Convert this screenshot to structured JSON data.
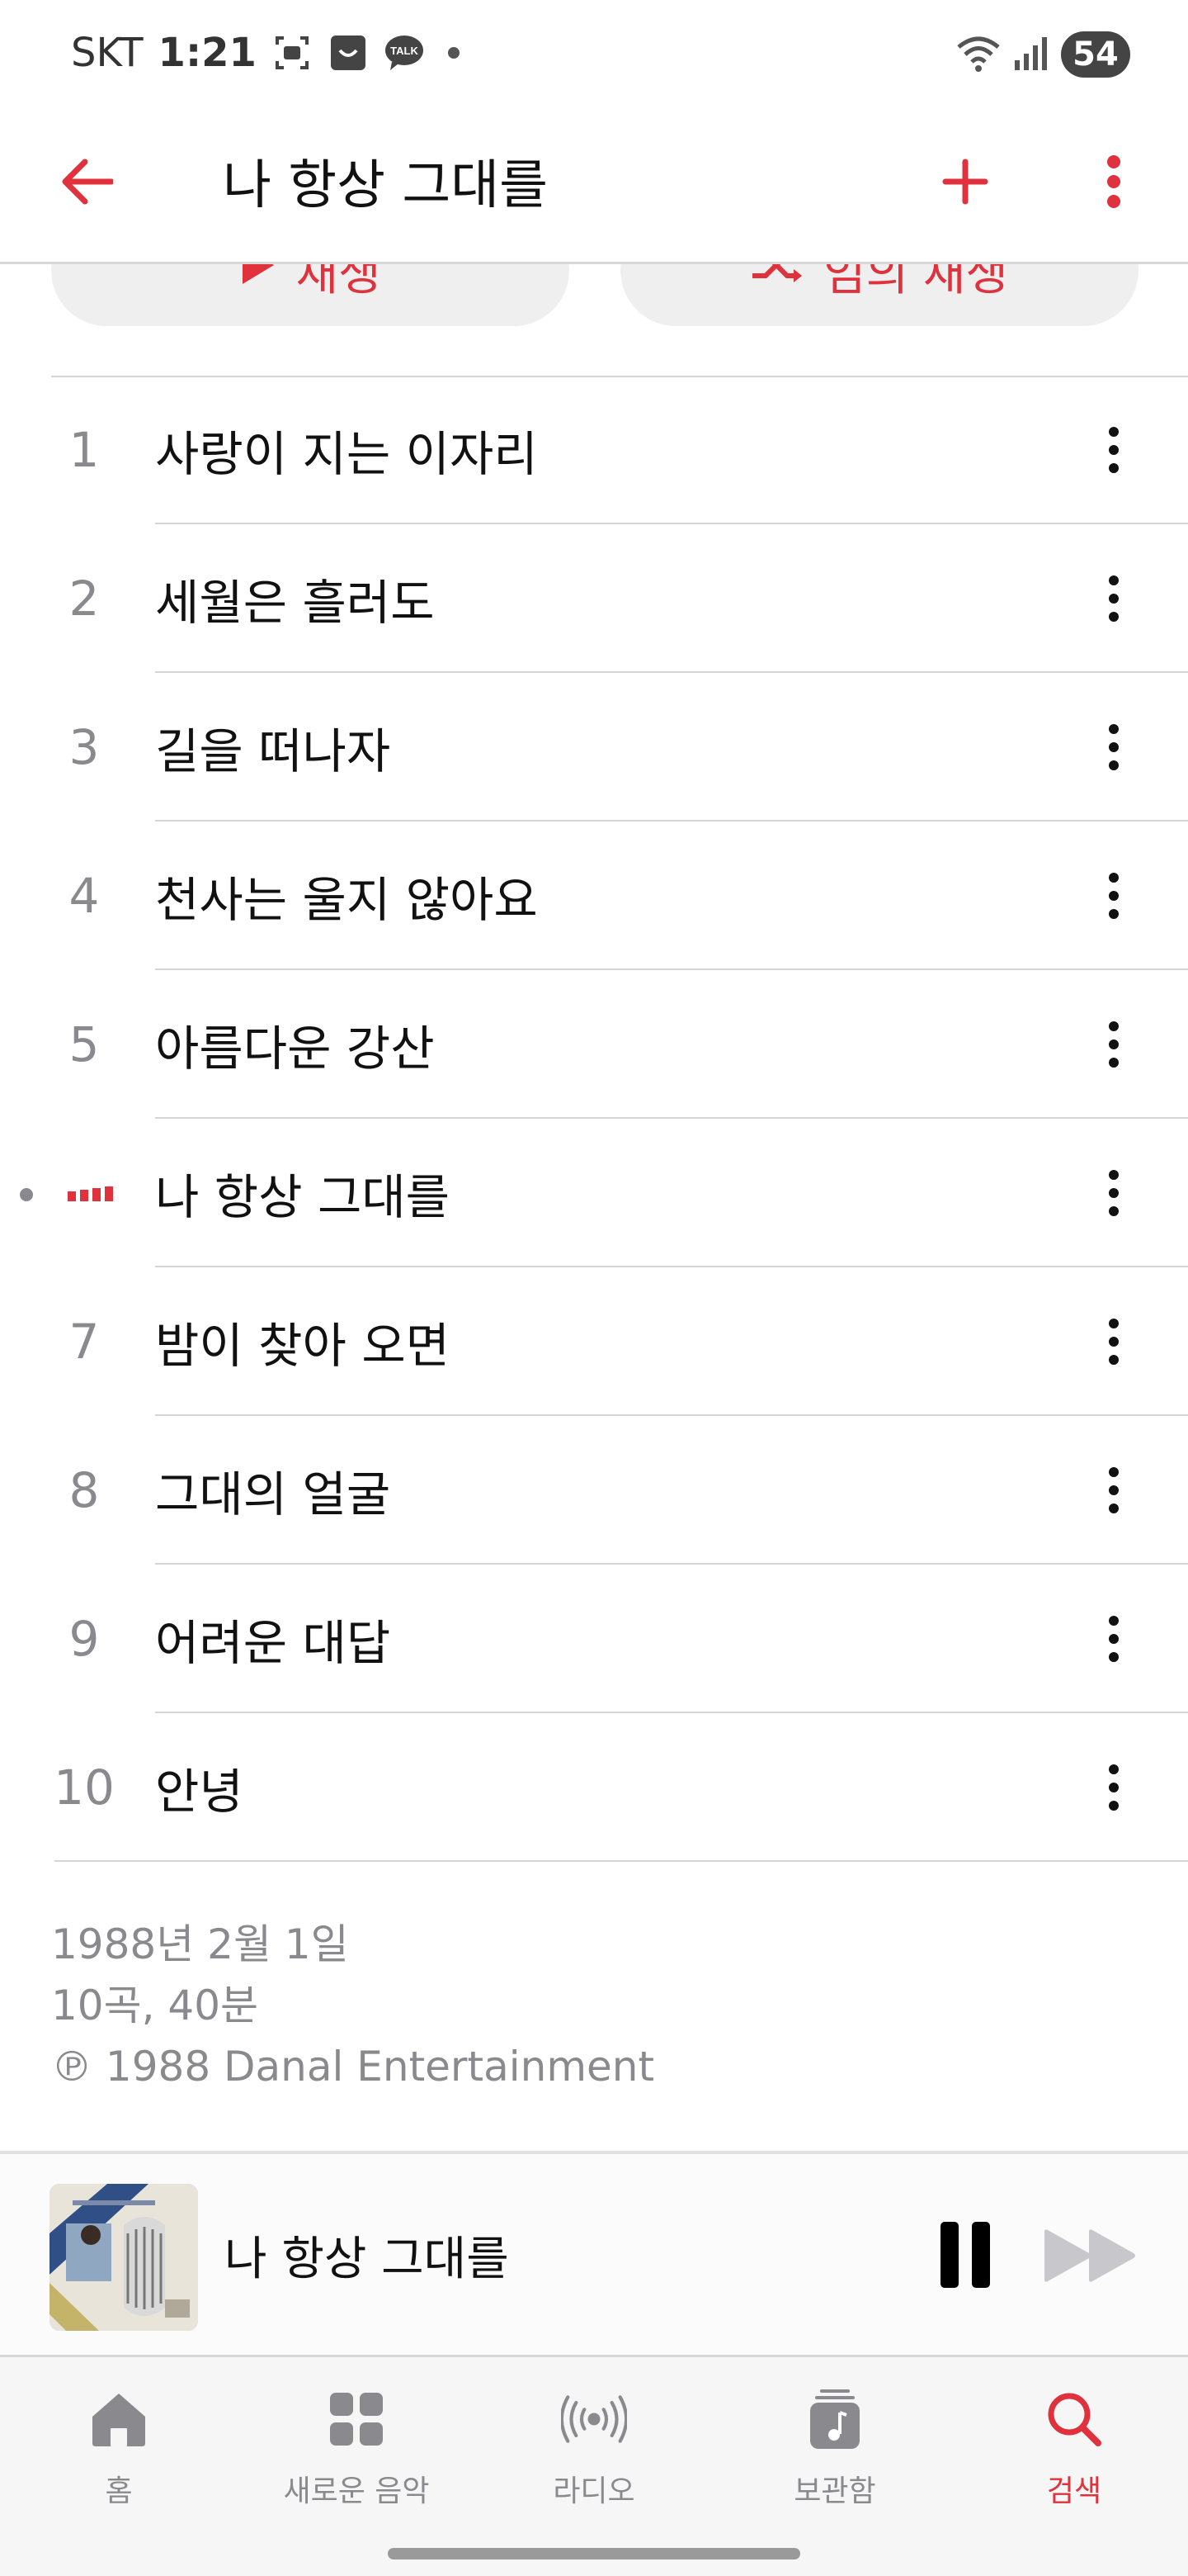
{
  "status_bar": {
    "carrier": "SKT",
    "time": "1:21",
    "battery": "54"
  },
  "header": {
    "title": "나 항상 그대를",
    "accent_color": "#e0323c"
  },
  "actions": {
    "play_label": "재생",
    "shuffle_label": "임의 재생"
  },
  "tracks": [
    {
      "number": "1",
      "title": "사랑이 지는 이자리"
    },
    {
      "number": "2",
      "title": "세월은 흘러도"
    },
    {
      "number": "3",
      "title": "길을 떠나자"
    },
    {
      "number": "4",
      "title": "천사는 울지 않아요"
    },
    {
      "number": "5",
      "title": "아름다운 강산"
    },
    {
      "number": "",
      "title": "나 항상 그대를",
      "now_playing": true
    },
    {
      "number": "7",
      "title": "밤이 찾아 오면"
    },
    {
      "number": "8",
      "title": "그대의 얼굴"
    },
    {
      "number": "9",
      "title": "어려운 대답"
    },
    {
      "number": "10",
      "title": "안녕"
    }
  ],
  "album_info": {
    "release_date": "1988년 2월 1일",
    "summary": "10곡, 40분",
    "copyright": "℗ 1988 Danal Entertainment"
  },
  "mini_player": {
    "title": "나 항상 그대를",
    "artwork_icon": "album-artwork",
    "pause_icon": "pause-icon",
    "forward_icon": "forward-icon"
  },
  "tabs": [
    {
      "label": "홈",
      "icon": "home-icon",
      "active": false
    },
    {
      "label": "새로운 음악",
      "icon": "grid-icon",
      "active": false
    },
    {
      "label": "라디오",
      "icon": "radio-icon",
      "active": false
    },
    {
      "label": "보관함",
      "icon": "library-icon",
      "active": false
    },
    {
      "label": "검색",
      "icon": "search-icon",
      "active": true
    }
  ]
}
